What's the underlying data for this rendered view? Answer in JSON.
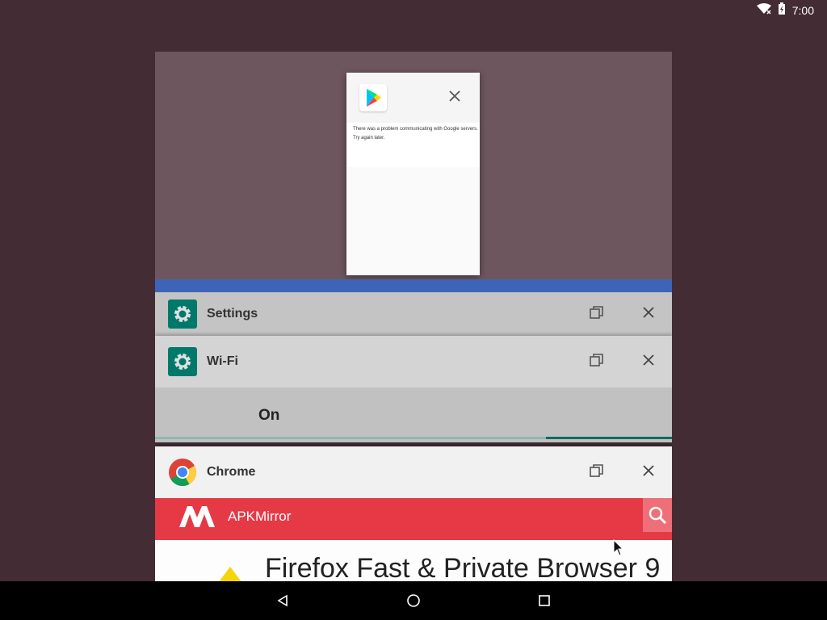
{
  "status_bar": {
    "time": "7:00",
    "icons": [
      "wifi-icon",
      "battery-charging-icon"
    ]
  },
  "recents": {
    "play_store_card": {
      "app_icon": "google-play-icon",
      "message": "There was a problem communicating with Google servers.",
      "retry_text": "Try again later."
    },
    "settings_card": {
      "title": "Settings",
      "icon": "gear-icon"
    },
    "wifi_card": {
      "title": "Wi-Fi",
      "icon": "gear-icon",
      "toggle_label": "On"
    },
    "chrome_card": {
      "title": "Chrome",
      "icon": "chrome-icon",
      "site_name": "APKMirror",
      "page_heading": "Firefox Fast & Private Browser 9"
    }
  },
  "colors": {
    "background": "#432c34",
    "settings_teal": "#00796b",
    "apkmirror_red": "#e63946"
  },
  "nav_bar": {
    "buttons": [
      "back-icon",
      "home-icon",
      "recents-icon"
    ]
  }
}
